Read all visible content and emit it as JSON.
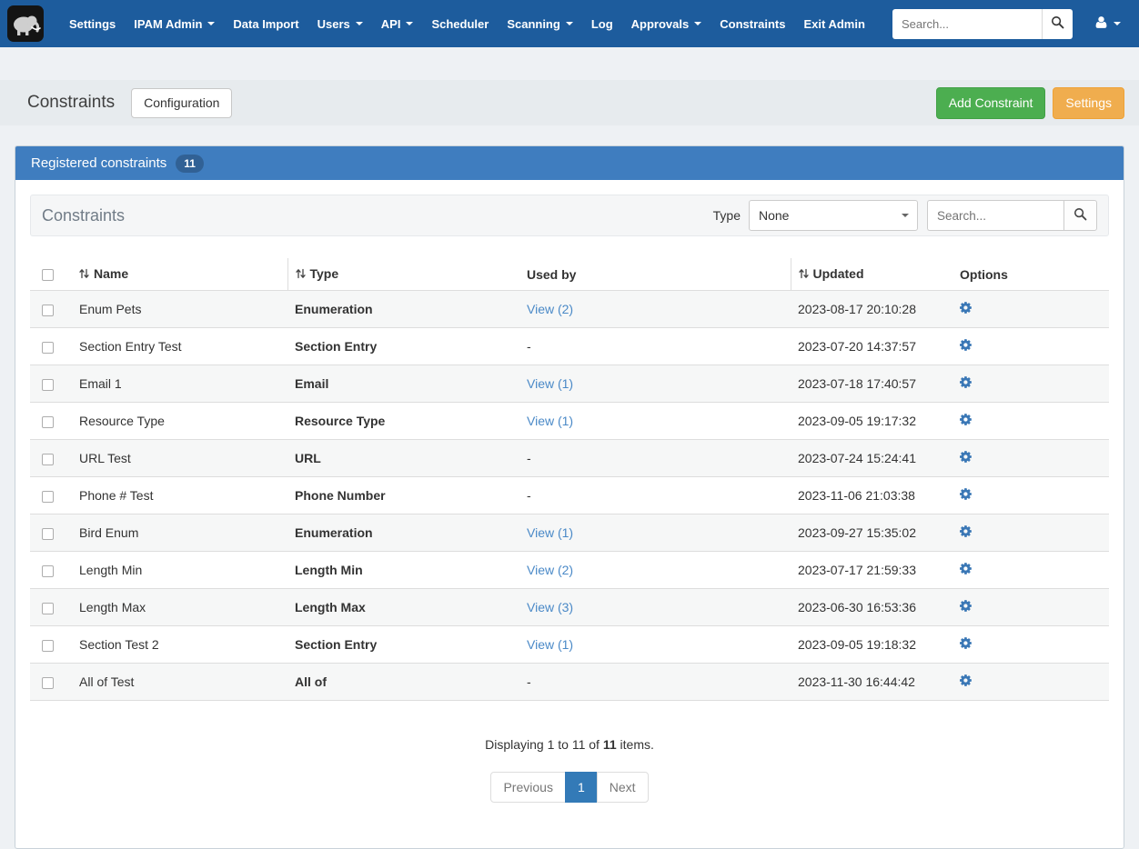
{
  "navbar": {
    "search": {
      "placeholder": "Search..."
    },
    "items": [
      {
        "label": "Settings",
        "dropdown": false
      },
      {
        "label": "IPAM Admin",
        "dropdown": true
      },
      {
        "label": "Data Import",
        "dropdown": false
      },
      {
        "label": "Users",
        "dropdown": true
      },
      {
        "label": "API",
        "dropdown": true
      },
      {
        "label": "Scheduler",
        "dropdown": false
      },
      {
        "label": "Scanning",
        "dropdown": true
      },
      {
        "label": "Log",
        "dropdown": false
      },
      {
        "label": "Approvals",
        "dropdown": true
      },
      {
        "label": "Constraints",
        "dropdown": false
      },
      {
        "label": "Exit Admin",
        "dropdown": false
      }
    ]
  },
  "page_header": {
    "title": "Constraints",
    "buttons": {
      "configuration": "Configuration",
      "add_constraint": "Add Constraint",
      "settings": "Settings"
    }
  },
  "panel": {
    "title": "Registered constraints",
    "count_badge": "11",
    "toolbar": {
      "title": "Constraints",
      "type_label": "Type",
      "type_selected": "None",
      "search_placeholder": "Search..."
    },
    "table": {
      "headers": {
        "name": "Name",
        "type": "Type",
        "used_by": "Used by",
        "updated": "Updated",
        "options": "Options"
      },
      "rows": [
        {
          "name": "Enum Pets",
          "type": "Enumeration",
          "used_by": "View (2)",
          "used_by_is_link": true,
          "updated": "2023-08-17 20:10:28"
        },
        {
          "name": "Section Entry Test",
          "type": "Section Entry",
          "used_by": "-",
          "used_by_is_link": false,
          "updated": "2023-07-20 14:37:57"
        },
        {
          "name": "Email 1",
          "type": "Email",
          "used_by": "View (1)",
          "used_by_is_link": true,
          "updated": "2023-07-18 17:40:57"
        },
        {
          "name": "Resource Type",
          "type": "Resource Type",
          "used_by": "View (1)",
          "used_by_is_link": true,
          "updated": "2023-09-05 19:17:32"
        },
        {
          "name": "URL Test",
          "type": "URL",
          "used_by": "-",
          "used_by_is_link": false,
          "updated": "2023-07-24 15:24:41"
        },
        {
          "name": "Phone # Test",
          "type": "Phone Number",
          "used_by": "-",
          "used_by_is_link": false,
          "updated": "2023-11-06 21:03:38"
        },
        {
          "name": "Bird Enum",
          "type": "Enumeration",
          "used_by": "View (1)",
          "used_by_is_link": true,
          "updated": "2023-09-27 15:35:02"
        },
        {
          "name": "Length Min",
          "type": "Length Min",
          "used_by": "View (2)",
          "used_by_is_link": true,
          "updated": "2023-07-17 21:59:33"
        },
        {
          "name": "Length Max",
          "type": "Length Max",
          "used_by": "View (3)",
          "used_by_is_link": true,
          "updated": "2023-06-30 16:53:36"
        },
        {
          "name": "Section Test 2",
          "type": "Section Entry",
          "used_by": "View (1)",
          "used_by_is_link": true,
          "updated": "2023-09-05 19:18:32"
        },
        {
          "name": "All of Test",
          "type": "All of",
          "used_by": "-",
          "used_by_is_link": false,
          "updated": "2023-11-30 16:44:42"
        }
      ]
    },
    "footer": {
      "display_prefix": "Displaying 1 to 11 of",
      "display_total": "11",
      "display_suffix": "items.",
      "pagination": {
        "previous": "Previous",
        "current_page": "1",
        "next": "Next"
      }
    }
  },
  "icons": {
    "logo": "mammoth-logo-icon",
    "navbar_search": "search-icon",
    "user": "user-icon",
    "dropdown": "caret-down-icon",
    "sort": "sort-icon",
    "toolbar_search": "search-icon",
    "row_options": "gear-icon"
  },
  "colors": {
    "navbar": "#1d5c9d",
    "panel_header": "#3f7dbf",
    "add_button": "#4cae50",
    "settings_button": "#f0ad4e",
    "link": "#4a89c7",
    "pagination_active": "#337ab7"
  }
}
